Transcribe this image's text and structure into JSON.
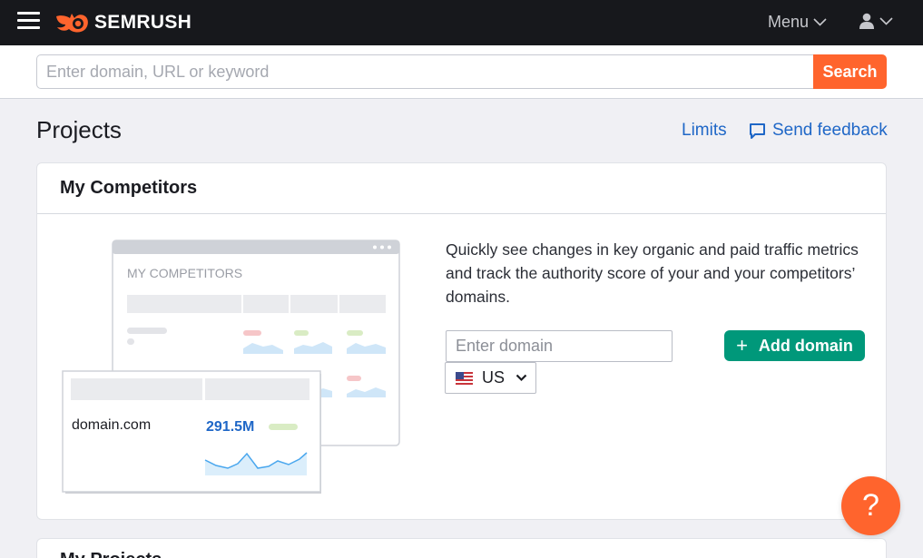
{
  "brand": {
    "name": "SEMRUSH",
    "accent": "#ff642d"
  },
  "topbar": {
    "menu_label": "Menu"
  },
  "search": {
    "placeholder": "Enter domain, URL or keyword",
    "value": "",
    "button_label": "Search"
  },
  "header": {
    "title": "Projects",
    "limits_label": "Limits",
    "feedback_label": "Send feedback"
  },
  "competitors_card": {
    "title": "My Competitors",
    "description": "Quickly see changes in key organic and paid traffic metrics and track the authority score of your and your competitors’ domains.",
    "domain_placeholder": "Enter domain",
    "domain_value": "",
    "country": "US",
    "add_button_label": "Add domain",
    "illustration": {
      "header_label": "MY COMPETITORS",
      "domain_label": "domain.com",
      "metric_value": "291.5M"
    }
  },
  "projects_card": {
    "title": "My Projects"
  },
  "help": {
    "label": "?"
  },
  "icons": {
    "menu": "hamburger-icon",
    "user": "user-icon",
    "feedback": "feedback-bubble-icon",
    "flag": "us-flag-icon",
    "chevron": "chevron-down-icon"
  },
  "colors": {
    "link": "#1f67c7",
    "green": "#00987a",
    "topbar": "#17181c"
  }
}
